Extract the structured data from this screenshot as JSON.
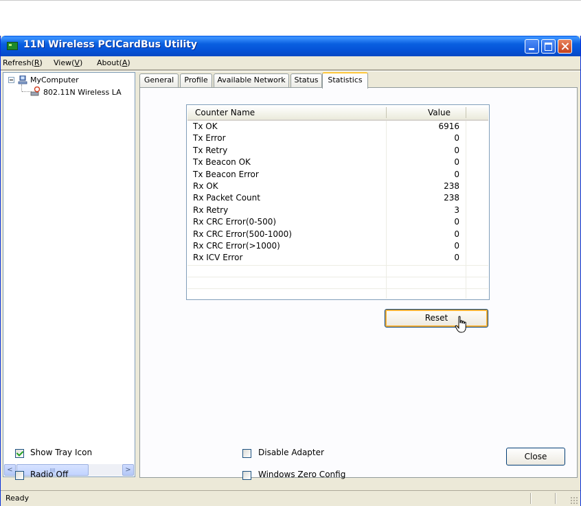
{
  "window": {
    "title": "11N Wireless PCICardBus Utility"
  },
  "menu": [
    {
      "label": "Refresh(",
      "key": "R",
      "suffix": ")"
    },
    {
      "label": "View(",
      "key": "V",
      "suffix": ")"
    },
    {
      "label": "About(",
      "key": "A",
      "suffix": ")"
    }
  ],
  "tree": {
    "root": "MyComputer",
    "child": "802.11N Wireless LA"
  },
  "scrollbar": {
    "left_arrow": "<",
    "right_arrow": ">"
  },
  "tabs": [
    {
      "label": "General",
      "active": false
    },
    {
      "label": "Profile",
      "active": false
    },
    {
      "label": "Available Network",
      "active": false
    },
    {
      "label": "Status",
      "active": false
    },
    {
      "label": "Statistics",
      "active": true
    }
  ],
  "statistics": {
    "headers": {
      "name": "Counter Name",
      "value": "Value"
    },
    "rows": [
      {
        "name": "Tx OK",
        "value": "6916"
      },
      {
        "name": "Tx Error",
        "value": "0"
      },
      {
        "name": "Tx Retry",
        "value": "0"
      },
      {
        "name": "Tx Beacon OK",
        "value": "0"
      },
      {
        "name": "Tx Beacon Error",
        "value": "0"
      },
      {
        "name": "Rx OK",
        "value": "238"
      },
      {
        "name": "Rx Packet Count",
        "value": "238"
      },
      {
        "name": "Rx Retry",
        "value": "3"
      },
      {
        "name": "Rx CRC Error(0-500)",
        "value": "0"
      },
      {
        "name": "Rx CRC Error(500-1000)",
        "value": "0"
      },
      {
        "name": "Rx CRC Error(>1000)",
        "value": "0"
      },
      {
        "name": "Rx ICV Error",
        "value": "0"
      }
    ],
    "reset_label": "Reset"
  },
  "options": {
    "show_tray_icon": {
      "label": "Show Tray Icon",
      "checked": true
    },
    "radio_off": {
      "label": "Radio Off",
      "checked": false
    },
    "disable_adapter": {
      "label": "Disable Adapter",
      "checked": false
    },
    "windows_zero_config": {
      "label": "Windows Zero Config",
      "checked": false
    }
  },
  "close_label": "Close",
  "status": {
    "text": "Ready"
  },
  "colors": {
    "titlebar": "#0553d8",
    "window_bg": "#ece9d8",
    "active_tab_accent": "#ffc83c",
    "focus_ring": "#f8b33a"
  }
}
